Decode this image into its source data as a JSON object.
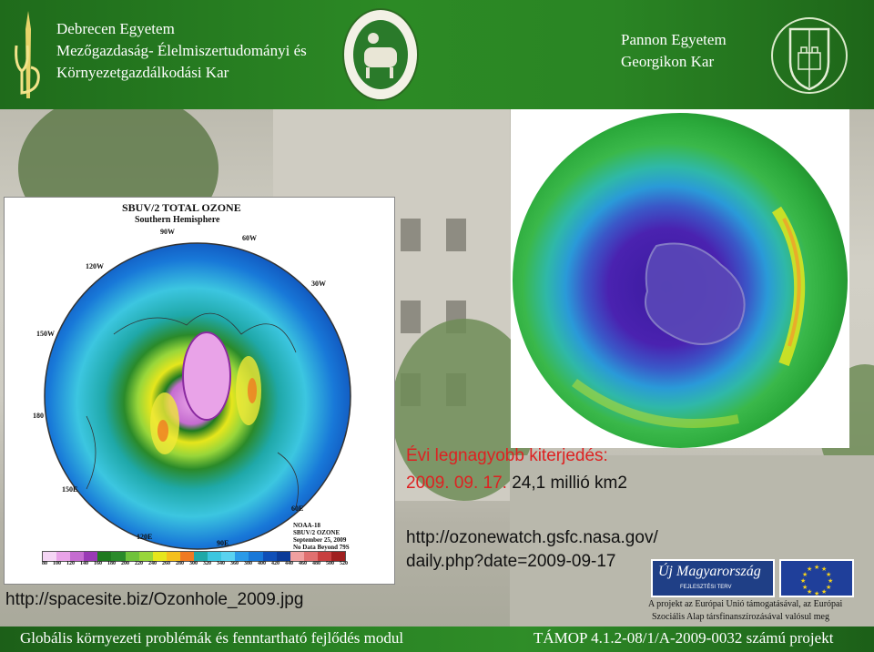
{
  "header": {
    "left_org_lines": [
      "Debrecen Egyetem",
      "Mezőgazdaság- Élelmiszertudományi és",
      "Környezetgazdálkodási Kar"
    ],
    "right_org_lines": [
      "Pannon Egyetem",
      "Georgikon Kar"
    ],
    "logos": [
      "ud-monogram-icon",
      "faculty-seal-icon",
      "university-shield-icon"
    ]
  },
  "left_map": {
    "title": "SBUV/2 TOTAL OZONE",
    "subtitle": "Southern Hemisphere",
    "longitude_labels": [
      "90W",
      "60W",
      "120W",
      "30W",
      "150W",
      "180",
      "150E",
      "60E",
      "120E",
      "90E"
    ],
    "info_lines": [
      "NOAA-18",
      "SBUV/2 OZONE",
      "September 25, 2009",
      "No Data Beyond 79S"
    ],
    "scale_values": [
      "80",
      "100",
      "120",
      "140",
      "160",
      "180",
      "200",
      "220",
      "240",
      "260",
      "280",
      "300",
      "320",
      "340",
      "360",
      "380",
      "400",
      "420",
      "440",
      "460",
      "480",
      "500",
      "520"
    ],
    "source_url": "http://spacesite.biz/Ozonhole_2009.jpg"
  },
  "right_globe": {
    "caption_line1": "Évi legnagyobb kiterjedés:",
    "caption_date": "2009. 09. 17.",
    "caption_value": "24,1 millió km2",
    "source_url_line1": "http://ozonewatch.gsfc.nasa.gov/",
    "source_url_line2": "daily.php?date=2009-09-17"
  },
  "funding": {
    "logo_text": "Új Magyarország",
    "logo_subtext": "FEJLESZTÉSI TERV",
    "note_line1": "A projekt az Európai Unió támogatásával, az Európai",
    "note_line2": "Szociális Alap társfinanszírozásával valósul meg"
  },
  "footer": {
    "left": "Globális környezeti problémák és fenntartható fejlődés modul",
    "right": "TÁMOP 4.1.2-08/1/A-2009-0032 számú projekt"
  },
  "colors": {
    "header_green": "#2c8a25",
    "caption_red": "#d22222",
    "ozone_hole": "#4a1fa8",
    "ozone_high": "#e0e61c"
  }
}
